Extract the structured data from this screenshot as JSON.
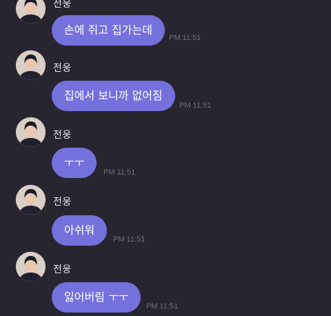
{
  "colors": {
    "background": "#262530",
    "bubble": "#7470dc",
    "sender_text": "#e8e8ee",
    "time_text": "#6e6d7c"
  },
  "messages": [
    {
      "sender": "전웅",
      "text": "손에 쥐고 집가는데",
      "time": "PM 11:51",
      "avatar_icon": "profile-photo-icon"
    },
    {
      "sender": "전웅",
      "text": "집에서 보니까 없어짐",
      "time": "PM 11:51",
      "avatar_icon": "profile-photo-icon"
    },
    {
      "sender": "전웅",
      "text": "ㅜㅜ",
      "time": "PM 11:51",
      "avatar_icon": "profile-photo-icon"
    },
    {
      "sender": "전웅",
      "text": "아쉬워",
      "time": "PM 11:51",
      "avatar_icon": "profile-photo-icon"
    },
    {
      "sender": "전웅",
      "text": "잃어버림 ㅜㅜ",
      "time": "PM 11:51",
      "avatar_icon": "profile-photo-icon"
    }
  ]
}
